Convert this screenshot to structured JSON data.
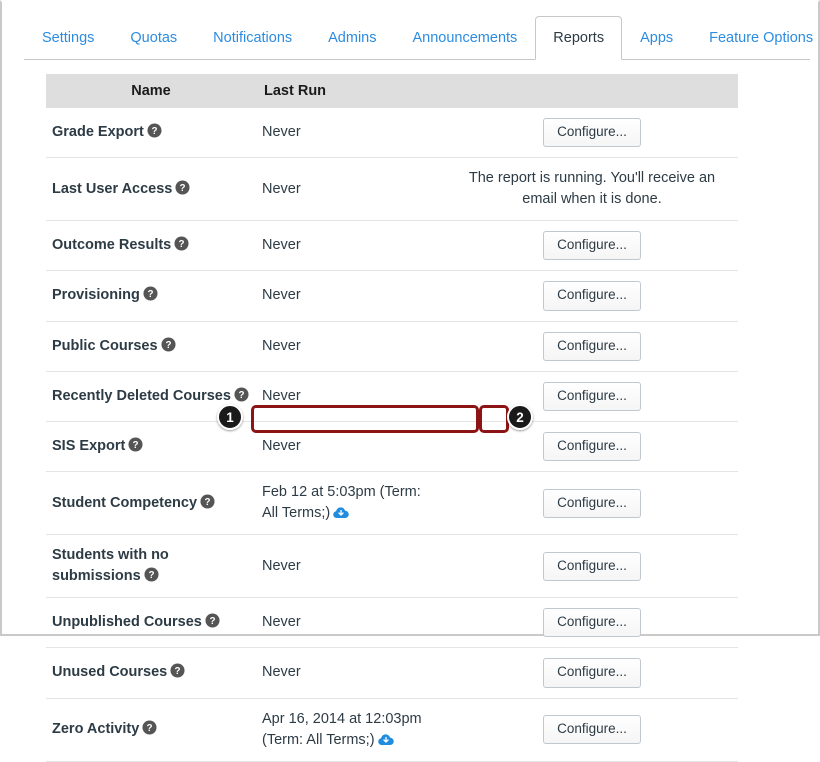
{
  "tabs": [
    {
      "label": "Settings",
      "active": false
    },
    {
      "label": "Quotas",
      "active": false
    },
    {
      "label": "Notifications",
      "active": false
    },
    {
      "label": "Admins",
      "active": false
    },
    {
      "label": "Announcements",
      "active": false
    },
    {
      "label": "Reports",
      "active": true
    },
    {
      "label": "Apps",
      "active": false
    },
    {
      "label": "Feature Options",
      "active": false
    }
  ],
  "table": {
    "headers": {
      "name": "Name",
      "last_run": "Last Run",
      "action": ""
    },
    "rows": [
      {
        "name": "Grade Export",
        "help": true,
        "last_run": "Never",
        "has_download": false,
        "action_type": "button",
        "action_label": "Configure...",
        "message": ""
      },
      {
        "name": "Last User Access",
        "help": true,
        "last_run": "Never",
        "has_download": false,
        "action_type": "message",
        "action_label": "",
        "message": "The report is running. You'll receive an email when it is done."
      },
      {
        "name": "Outcome Results",
        "help": true,
        "last_run": "Never",
        "has_download": false,
        "action_type": "button",
        "action_label": "Configure...",
        "message": ""
      },
      {
        "name": "Provisioning",
        "help": true,
        "last_run": "Never",
        "has_download": false,
        "action_type": "button",
        "action_label": "Configure...",
        "message": ""
      },
      {
        "name": "Public Courses",
        "help": true,
        "last_run": "Never",
        "has_download": false,
        "action_type": "button",
        "action_label": "Configure...",
        "message": ""
      },
      {
        "name": "Recently Deleted Courses",
        "help": true,
        "last_run": "Never",
        "has_download": false,
        "action_type": "button",
        "action_label": "Configure...",
        "message": ""
      },
      {
        "name": "SIS Export",
        "help": true,
        "last_run": "Never",
        "has_download": false,
        "action_type": "button",
        "action_label": "Configure...",
        "message": ""
      },
      {
        "name": "Student Competency",
        "help": true,
        "last_run": "Feb 12 at 5:03pm (Term: All Terms;)",
        "has_download": true,
        "action_type": "button",
        "action_label": "Configure...",
        "message": ""
      },
      {
        "name": "Students with no submissions",
        "help": true,
        "last_run": "Never",
        "has_download": false,
        "action_type": "button",
        "action_label": "Configure...",
        "message": ""
      },
      {
        "name": "Unpublished Courses",
        "help": true,
        "last_run": "Never",
        "has_download": false,
        "action_type": "button",
        "action_label": "Configure...",
        "message": ""
      },
      {
        "name": "Unused Courses",
        "help": true,
        "last_run": "Never",
        "has_download": false,
        "action_type": "button",
        "action_label": "Configure...",
        "message": ""
      },
      {
        "name": "Zero Activity",
        "help": true,
        "last_run": "Apr 16, 2014 at 12:03pm (Term: All Terms;)",
        "has_download": true,
        "action_type": "button",
        "action_label": "Configure...",
        "message": ""
      }
    ]
  },
  "annotations": [
    {
      "number": "1",
      "target": "student-competency-last-run"
    },
    {
      "number": "2",
      "target": "student-competency-download-icon"
    }
  ],
  "icons": {
    "help": "help-circle-icon",
    "download": "cloud-download-icon"
  },
  "colors": {
    "tab_link": "#2d8ce0",
    "tab_active_text": "#2d3b45",
    "header_bg": "#dedede",
    "annotation_outline": "#8c1414",
    "annotation_badge_bg": "#1a1a1a",
    "download_icon": "#1f8ce0"
  }
}
